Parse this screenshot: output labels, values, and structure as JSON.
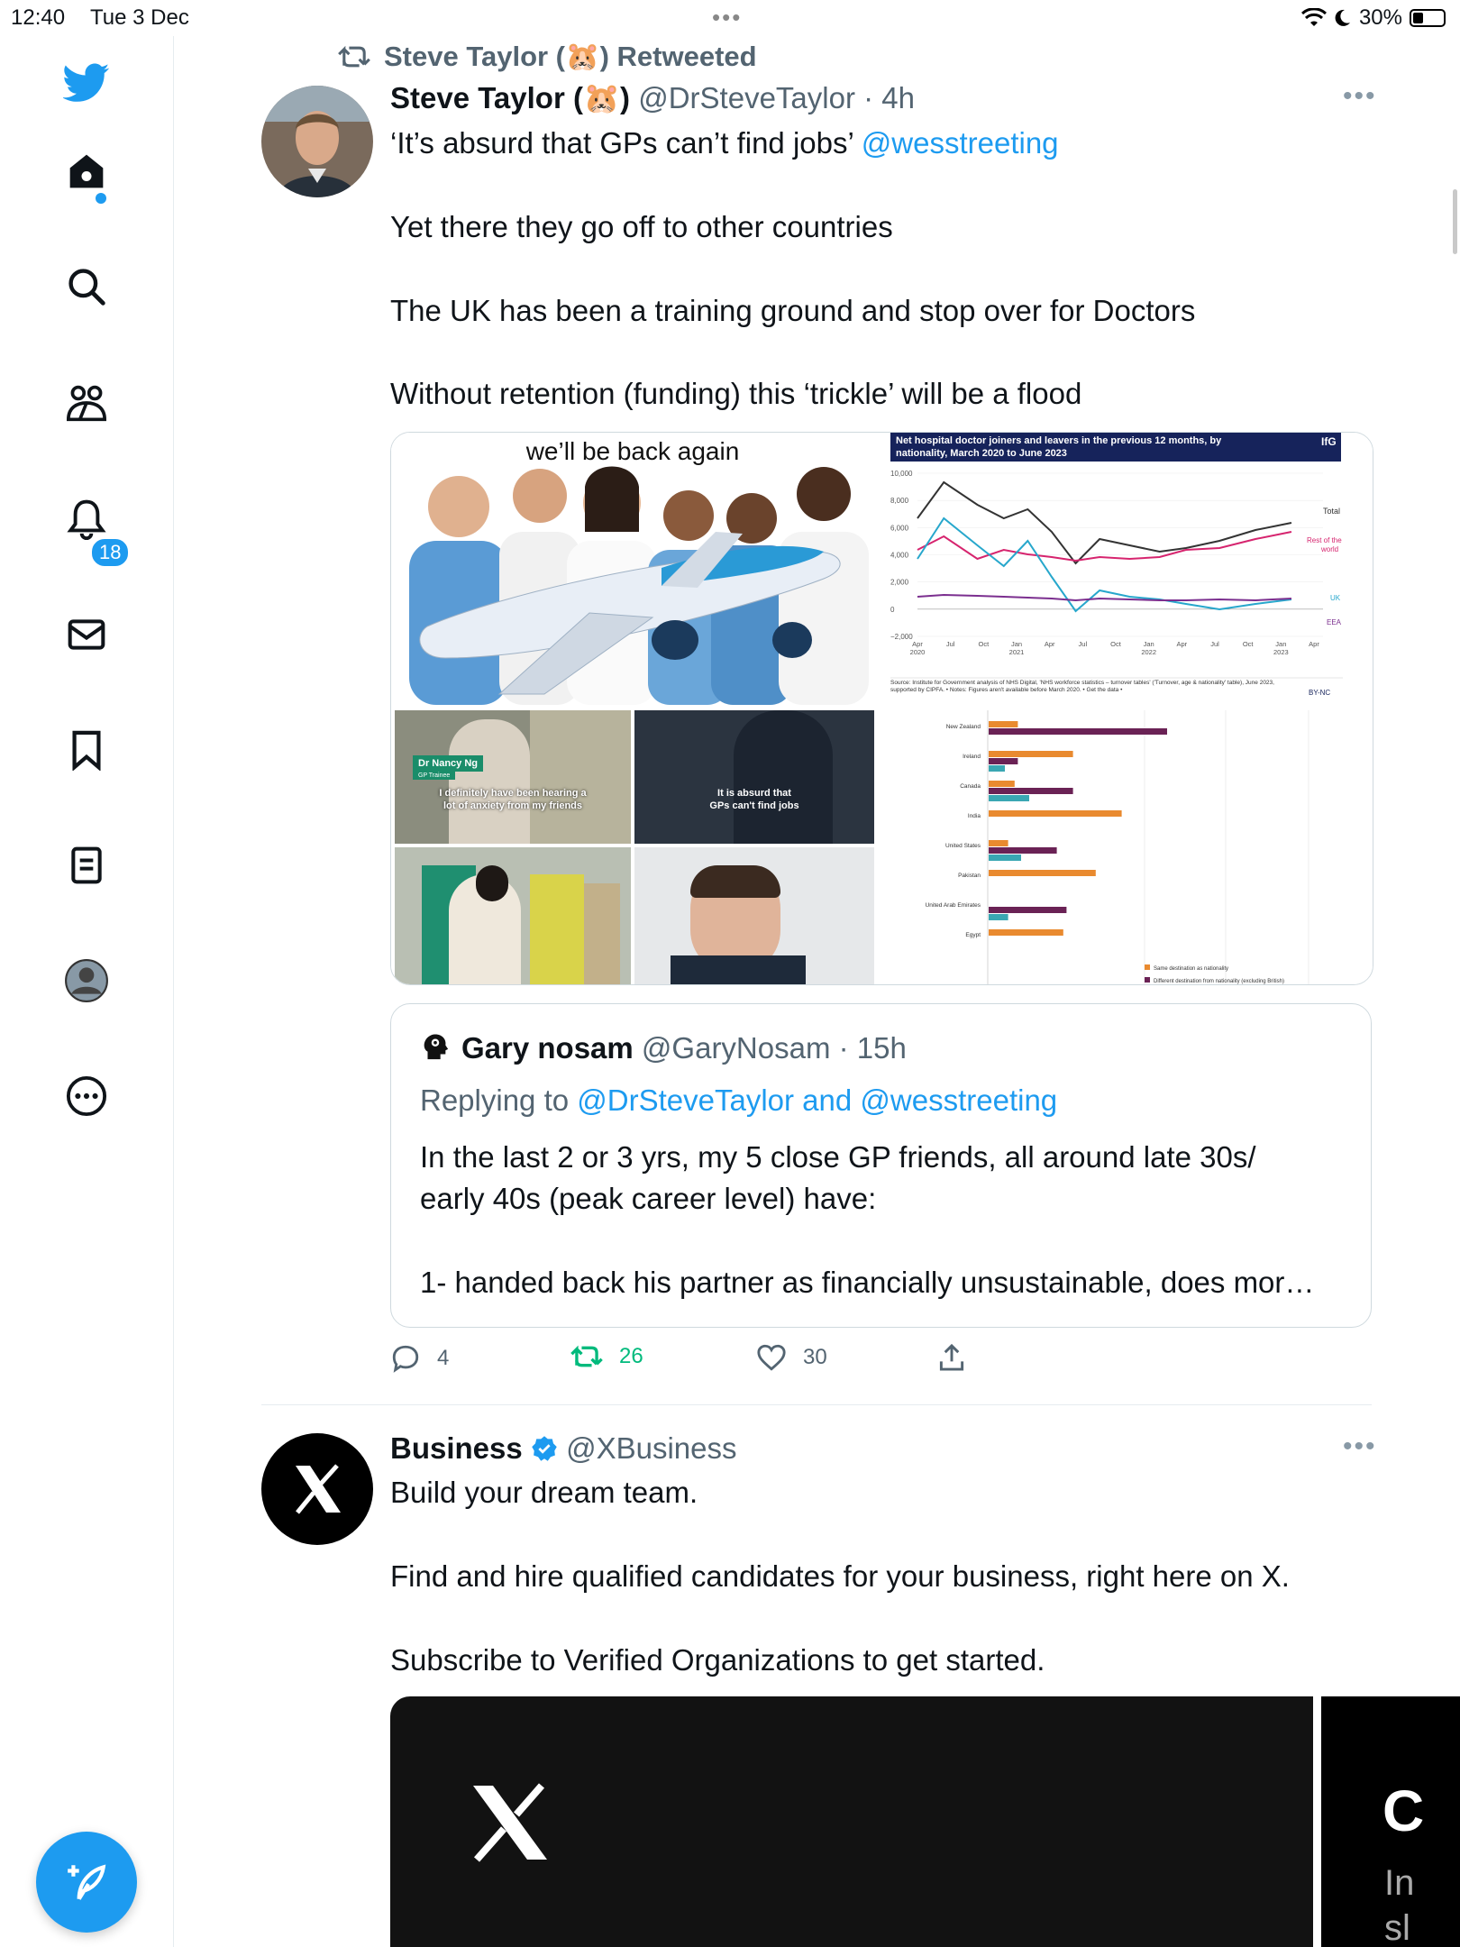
{
  "status_bar": {
    "time": "12:40",
    "date": "Tue 3 Dec",
    "battery": "30%",
    "battery_level": 0.3
  },
  "sidebar": {
    "items": [
      {
        "name": "twitter-logo-icon"
      },
      {
        "name": "home-icon"
      },
      {
        "name": "search-icon"
      },
      {
        "name": "communities-icon"
      },
      {
        "name": "notifications-icon",
        "badge": "18"
      },
      {
        "name": "messages-icon"
      },
      {
        "name": "bookmarks-icon"
      },
      {
        "name": "lists-icon"
      },
      {
        "name": "profile-icon"
      },
      {
        "name": "more-icon"
      }
    ],
    "compose_icon": "compose-icon"
  },
  "tweet1": {
    "retweet_line": "Steve Taylor (🐹) Retweeted",
    "name": "Steve Taylor (🐹)",
    "handle": "@DrSteveTaylor",
    "time": "4h",
    "text_line1": "‘It’s absurd that GPs can’t find jobs’ ",
    "mention": "@wesstreeting",
    "para2": "Yet there they go off to other countries",
    "para3": "The UK has been a training ground and stop over for Doctors",
    "para4": "Without retention (funding) this ‘trickle’ will be a flood",
    "media": {
      "meme_caption": "we’ll be back again",
      "chart": {
        "title_line1": "Net hospital doctor joiners and leavers in the previous 12 months, by",
        "title_line2": "nationality, March 2020 to June 2023",
        "brand": "IfG",
        "source": "Source: Institute for Government analysis of NHS Digital, 'NHS workforce statistics – turnover tables' ('Turnover, age & nationality' table), June 2023, supported by CIPFA. • Notes: Figures aren't available before March 2020. • Get the data •",
        "license": "BY-NC",
        "y_ticks": [
          "10,000",
          "8,000",
          "6,000",
          "4,000",
          "2,000",
          "0",
          "−2,000"
        ],
        "x_ticks": [
          {
            "l1": "Apr",
            "l2": "2020"
          },
          {
            "l1": "Jul",
            "l2": ""
          },
          {
            "l1": "Oct",
            "l2": ""
          },
          {
            "l1": "Jan",
            "l2": "2021"
          },
          {
            "l1": "Apr",
            "l2": ""
          },
          {
            "l1": "Jul",
            "l2": ""
          },
          {
            "l1": "Oct",
            "l2": ""
          },
          {
            "l1": "Jan",
            "l2": "2022"
          },
          {
            "l1": "Apr",
            "l2": ""
          },
          {
            "l1": "Jul",
            "l2": ""
          },
          {
            "l1": "Oct",
            "l2": ""
          },
          {
            "l1": "Jan",
            "l2": "2023"
          },
          {
            "l1": "Apr",
            "l2": ""
          }
        ],
        "labels": {
          "total": "Total",
          "row1": "Rest of the",
          "row2": "world",
          "uk": "UK",
          "eea": "EEA"
        }
      },
      "video": {
        "name_tag": "Dr Nancy Ng",
        "name_sub": "GP Trainee",
        "caption1": "I definitely have been hearing a",
        "caption2": "lot of anxiety from my friends",
        "caption3": "It is absurd that",
        "caption4": "GPs can't find jobs"
      },
      "bar_chart": {
        "countries": [
          "New Zealand",
          "Ireland",
          "Canada",
          "India",
          "United States",
          "Pakistan",
          "United Arab Emirates",
          "Egypt"
        ],
        "legend1": "Same destination as nationality",
        "legend2": "Different destination from nationality (excluding British)"
      }
    },
    "quote": {
      "name": "Gary nosam",
      "handle": "@GaryNosam",
      "time": "15h",
      "replying_prefix": "Replying to ",
      "replying_to1": "@DrSteveTaylor",
      "replying_and": " and ",
      "replying_to2": "@wesstreeting",
      "line1": "In the last 2 or 3 yrs, my 5 close GP friends, all around late 30s/",
      "line2": "early 40s (peak career level) have:",
      "line3": "1- handed back his partner as financially unsustainable, does mor…"
    },
    "actions": {
      "replies": "4",
      "retweets": "26",
      "likes": "30"
    },
    "colors": {
      "retweet_green": "#00ba7c",
      "accent": "#1d9bf0"
    }
  },
  "tweet2": {
    "name": "Business",
    "handle": "@XBusiness",
    "para1": "Build your dream team.",
    "para2": "Find and hire qualified candidates for your business, right here on X.",
    "para3": "Subscribe to Verified Organizations to get started.",
    "card2_big": "C",
    "card2_small1": "In",
    "card2_small2": "sl"
  }
}
